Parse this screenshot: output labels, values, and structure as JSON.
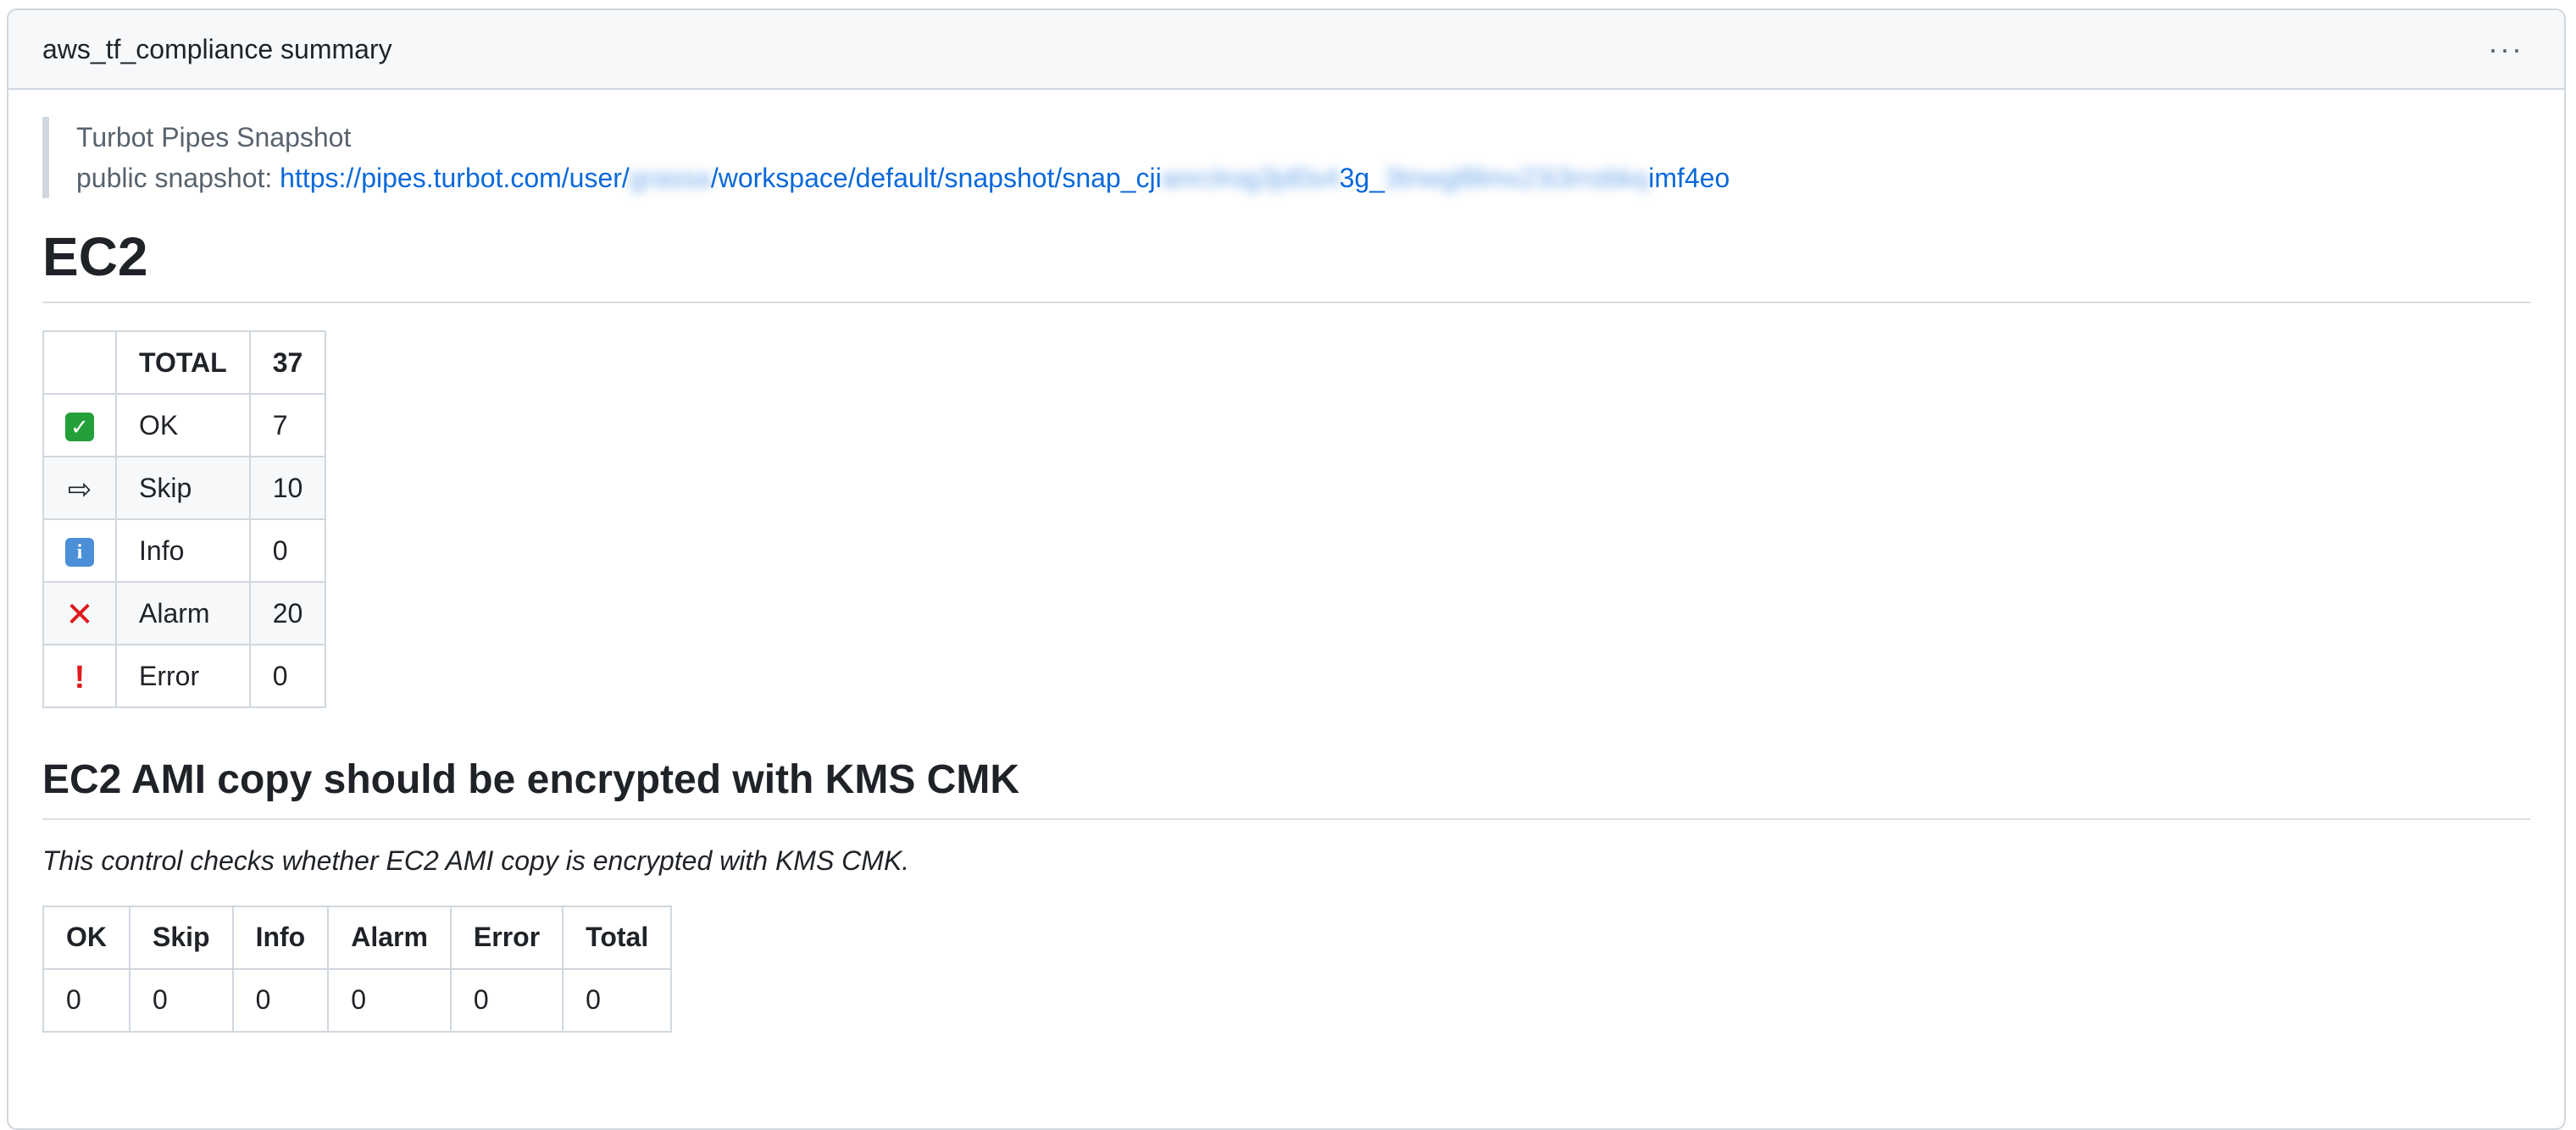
{
  "card": {
    "title": "aws_tf_compliance summary",
    "menu_label": "···"
  },
  "snapshot": {
    "heading": "Turbot Pipes Snapshot",
    "label": "public snapshot: ",
    "url_part1": "https://pipes.turbot.com/user/",
    "url_blur1": "grassa",
    "url_part2": "/workspace/default/snapshot/snap_cji",
    "url_blur2": "anrclrog3jd0s4",
    "url_part3": "3g_",
    "url_blur3": "3tnwgl8lmx23i3rrobkq",
    "url_part4": "imf4eo"
  },
  "section": {
    "title": "EC2"
  },
  "summary_table": {
    "header": {
      "label": "TOTAL",
      "value": "37"
    },
    "rows": [
      {
        "icon": "check-icon",
        "label": "OK",
        "value": "7"
      },
      {
        "icon": "arrow-right-icon",
        "label": "Skip",
        "value": "10"
      },
      {
        "icon": "info-icon",
        "label": "Info",
        "value": "0"
      },
      {
        "icon": "cross-icon",
        "label": "Alarm",
        "value": "20"
      },
      {
        "icon": "exclamation-icon",
        "label": "Error",
        "value": "0"
      }
    ]
  },
  "control": {
    "title": "EC2 AMI copy should be encrypted with KMS CMK",
    "description": "This control checks whether EC2 AMI copy is encrypted with KMS CMK.",
    "table": {
      "headers": [
        "OK",
        "Skip",
        "Info",
        "Alarm",
        "Error",
        "Total"
      ],
      "values": [
        "0",
        "0",
        "0",
        "0",
        "0",
        "0"
      ]
    }
  },
  "colors": {
    "link": "#0969da",
    "border": "#d0d7de",
    "header_bg": "#f6f8fa",
    "ok_green": "#23a03a",
    "alarm_red": "#e0191b",
    "info_blue": "#4a8fd8"
  }
}
